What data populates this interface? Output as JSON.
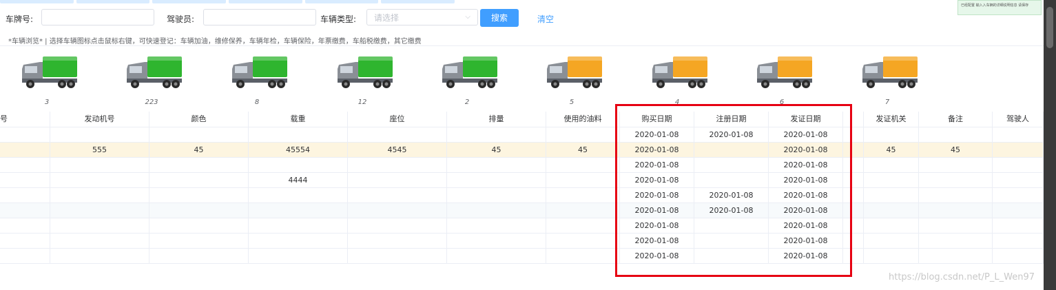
{
  "search": {
    "plate_label": "车牌号:",
    "plate_value": "",
    "driver_label": "驾驶员:",
    "driver_value": "",
    "type_label": "车辆类型:",
    "type_placeholder": "请选择",
    "search_button": "搜索",
    "clear_button": "清空"
  },
  "hint": "*车辆浏览* | 选择车辆图标点击鼠标右键，可快速登记：车辆加油，维修保养，车辆年检，车辆保险，年票缴费，车船税缴费，其它缴费",
  "trucks": [
    {
      "count": "3",
      "color": "green"
    },
    {
      "count": "223",
      "color": "green"
    },
    {
      "count": "8",
      "color": "green"
    },
    {
      "count": "12",
      "color": "green"
    },
    {
      "count": "2",
      "color": "green"
    },
    {
      "count": "5",
      "color": "orange"
    },
    {
      "count": "4",
      "color": "orange"
    },
    {
      "count": "6",
      "color": "orange"
    },
    {
      "count": "7",
      "color": "orange"
    }
  ],
  "table": {
    "headers": [
      "号",
      "发动机号",
      "颜色",
      "载重",
      "座位",
      "排量",
      "使用的油料",
      "购买日期",
      "注册日期",
      "发证日期",
      "",
      "发证机关",
      "备注",
      "驾驶人"
    ],
    "rows": [
      [
        "",
        "",
        "",
        "",
        "",
        "",
        "",
        "2020-01-08",
        "2020-01-08",
        "2020-01-08",
        "",
        "",
        "",
        ""
      ],
      [
        "",
        "555",
        "45",
        "45554",
        "4545",
        "45",
        "45",
        "2020-01-08",
        "",
        "2020-01-08",
        "",
        "45",
        "45",
        ""
      ],
      [
        "",
        "",
        "",
        "",
        "",
        "",
        "",
        "2020-01-08",
        "",
        "2020-01-08",
        "",
        "",
        "",
        ""
      ],
      [
        "",
        "",
        "",
        "4444",
        "",
        "",
        "",
        "2020-01-08",
        "",
        "2020-01-08",
        "",
        "",
        "",
        ""
      ],
      [
        "",
        "",
        "",
        "",
        "",
        "",
        "",
        "2020-01-08",
        "2020-01-08",
        "2020-01-08",
        "",
        "",
        "",
        ""
      ],
      [
        "",
        "",
        "",
        "",
        "",
        "",
        "",
        "2020-01-08",
        "2020-01-08",
        "2020-01-08",
        "",
        "",
        "",
        ""
      ],
      [
        "",
        "",
        "",
        "",
        "",
        "",
        "",
        "2020-01-08",
        "",
        "2020-01-08",
        "",
        "",
        "",
        ""
      ],
      [
        "",
        "",
        "",
        "",
        "",
        "",
        "",
        "2020-01-08",
        "",
        "2020-01-08",
        "",
        "",
        "",
        ""
      ],
      [
        "",
        "",
        "",
        "",
        "",
        "",
        "",
        "2020-01-08",
        "",
        "2020-01-08",
        "",
        "",
        "",
        ""
      ]
    ]
  },
  "colors": {
    "accent": "#409eff",
    "highlight_row": "#fdf5e0",
    "annotation_box": "#e60012",
    "truck_green": "#2fb52f",
    "truck_orange": "#f5a623"
  },
  "watermark": "https://blog.csdn.net/P_L_Wen97",
  "right_panel_text": "已经配置   输入入车辆的详细说明信息   请保存"
}
